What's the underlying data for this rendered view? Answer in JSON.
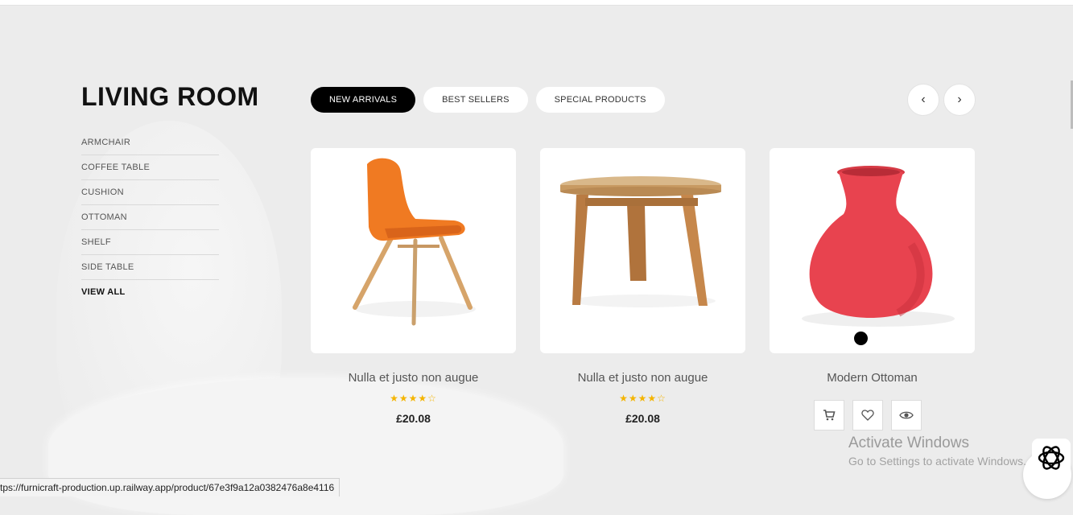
{
  "section": {
    "title": "LIVING ROOM",
    "categories": [
      "ARMCHAIR",
      "COFFEE TABLE",
      "CUSHION",
      "OTTOMAN",
      "SHELF",
      "SIDE TABLE",
      "VIEW ALL"
    ]
  },
  "tabs": [
    "NEW ARRIVALS",
    "BEST SELLERS",
    "SPECIAL PRODUCTS"
  ],
  "active_tab": "NEW ARRIVALS",
  "carousel": {
    "prev_icon": "‹",
    "next_icon": "›"
  },
  "products": [
    {
      "name": "Nulla et justo non augue",
      "rating": 4,
      "rating_text": "★★★★☆",
      "price": "£20.08",
      "image": "orange-chair"
    },
    {
      "name": "Nulla et justo non augue",
      "rating": 4,
      "rating_text": "★★★★☆",
      "price": "£20.08",
      "image": "wooden-side-table"
    },
    {
      "name": "Modern Ottoman",
      "image": "red-vase",
      "actions": [
        "cart-icon",
        "heart-icon",
        "eye-icon"
      ]
    }
  ],
  "watermark": {
    "title": "Activate Windows",
    "subtitle": "Go to Settings to activate Windows."
  },
  "status_bar": {
    "url": "tps://furnicraft-production.up.railway.app/product/67e3f9a12a0382476a8e4116"
  },
  "colors": {
    "accent": "#000000",
    "stars": "#f4b400",
    "vase": "#e8434f",
    "chair": "#f07a22"
  }
}
